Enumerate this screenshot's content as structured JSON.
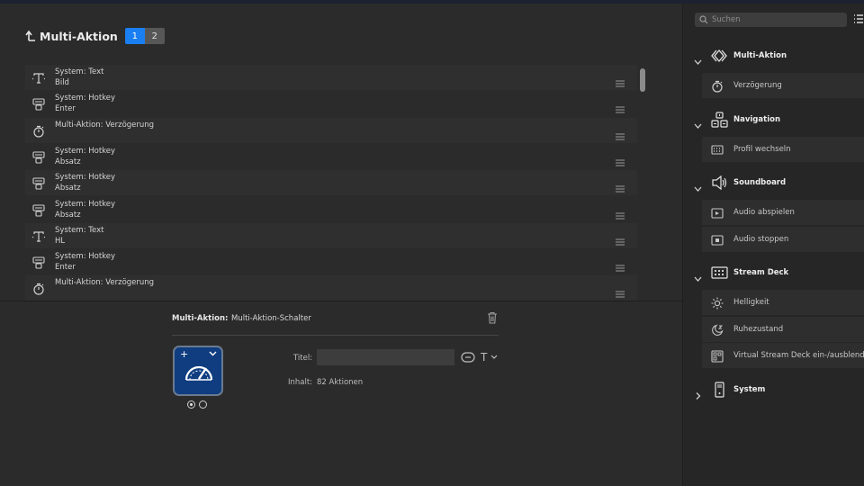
{
  "header": {
    "title": "Multi-Aktion",
    "pages": [
      "1",
      "2"
    ],
    "active_page": "1"
  },
  "actions": [
    {
      "icon": "text-icon",
      "line1": "System: Text",
      "line2": "Bild"
    },
    {
      "icon": "hotkey-icon",
      "line1": "System: Hotkey",
      "line2": "Enter"
    },
    {
      "icon": "timer-icon",
      "line1": "Multi-Aktion: Verzögerung",
      "line2": ""
    },
    {
      "icon": "hotkey-icon",
      "line1": "System: Hotkey",
      "line2": "Absatz"
    },
    {
      "icon": "hotkey-icon",
      "line1": "System: Hotkey",
      "line2": "Absatz"
    },
    {
      "icon": "hotkey-icon",
      "line1": "System: Hotkey",
      "line2": "Absatz"
    },
    {
      "icon": "text-icon",
      "line1": "System: Text",
      "line2": "HL"
    },
    {
      "icon": "hotkey-icon",
      "line1": "System: Hotkey",
      "line2": "Enter"
    },
    {
      "icon": "timer-icon",
      "line1": "Multi-Aktion: Verzögerung",
      "line2": ""
    }
  ],
  "inspector": {
    "label": "Multi-Aktion:",
    "value": "Multi-Aktion-Schalter",
    "title_label": "Titel:",
    "title_value": "",
    "content_label": "Inhalt:",
    "content_value": "82 Aktionen",
    "plus": "+",
    "font_glyph": "T"
  },
  "sidebar": {
    "search_placeholder": "Suchen",
    "categories": [
      {
        "label": "Multi-Aktion",
        "icon": "multi-action-icon",
        "expanded": true,
        "items": [
          {
            "label": "Verzögerung",
            "icon": "timer-icon"
          }
        ]
      },
      {
        "label": "Navigation",
        "icon": "navigation-icon",
        "expanded": true,
        "items": [
          {
            "label": "Profil wechseln",
            "icon": "profile-switch-icon"
          }
        ]
      },
      {
        "label": "Soundboard",
        "icon": "speaker-icon",
        "expanded": true,
        "items": [
          {
            "label": "Audio abspielen",
            "icon": "audio-play-icon"
          },
          {
            "label": "Audio stoppen",
            "icon": "audio-stop-icon"
          }
        ]
      },
      {
        "label": "Stream Deck",
        "icon": "stream-deck-icon",
        "expanded": true,
        "items": [
          {
            "label": "Helligkeit",
            "icon": "brightness-icon"
          },
          {
            "label": "Ruhezustand",
            "icon": "sleep-icon"
          },
          {
            "label": "Virtual Stream Deck ein-/ausblenden",
            "icon": "virtual-deck-icon"
          }
        ]
      },
      {
        "label": "System",
        "icon": "system-icon",
        "expanded": false,
        "items": []
      }
    ]
  },
  "colors": {
    "accent": "#1a7ff2",
    "key_background": "#0f3d80"
  }
}
